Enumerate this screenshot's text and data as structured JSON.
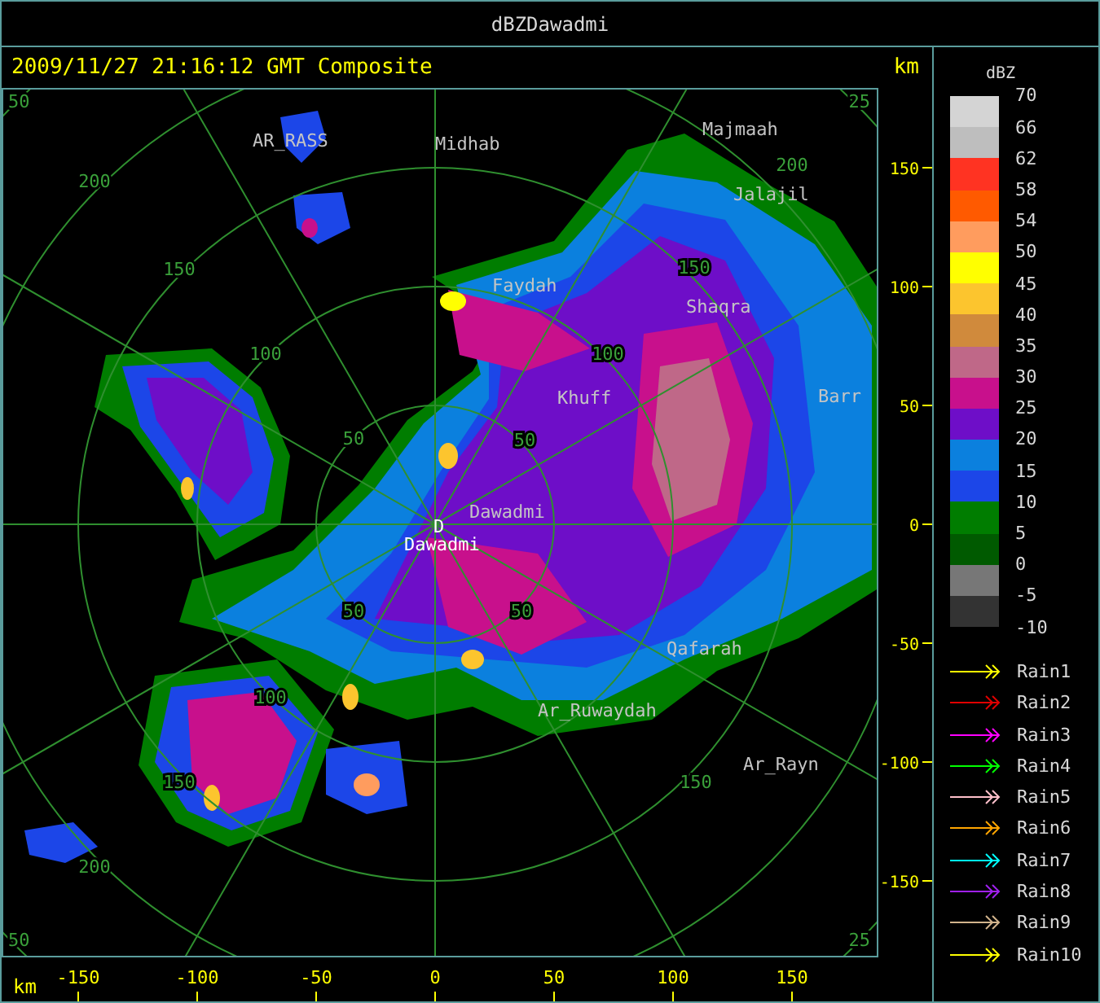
{
  "window": {
    "title": "dBZDawadmi"
  },
  "header": {
    "timestamp": "2009/11/27 21:16:12 GMT Composite"
  },
  "map": {
    "range_labels": {
      "nw": [
        "50",
        "100",
        "150",
        "200",
        "50"
      ],
      "ne": [
        "50",
        "100",
        "150",
        "200",
        "25"
      ],
      "sw": [
        "50",
        "100",
        "150",
        "200",
        "50"
      ],
      "se": [
        "50",
        "150",
        "25"
      ]
    },
    "places": [
      {
        "name": "AR_RASS",
        "kind": "town"
      },
      {
        "name": "Midhab",
        "kind": "town"
      },
      {
        "name": "Majmaah",
        "kind": "town"
      },
      {
        "name": "Jalajil",
        "kind": "town"
      },
      {
        "name": "Faydah",
        "kind": "town"
      },
      {
        "name": "Shaqra",
        "kind": "town"
      },
      {
        "name": "Khuff",
        "kind": "town"
      },
      {
        "name": "Barr",
        "kind": "town"
      },
      {
        "name": "Dawadmi",
        "kind": "town"
      },
      {
        "name": "D",
        "kind": "radar"
      },
      {
        "name": "Dawadmi",
        "kind": "radar"
      },
      {
        "name": "Qafarah",
        "kind": "town"
      },
      {
        "name": "Ar_Ruwaydah",
        "kind": "town"
      },
      {
        "name": "Ar_Rayn",
        "kind": "town"
      }
    ]
  },
  "y_axis": {
    "unit": "km",
    "ticks": [
      "150",
      "100",
      "50",
      "0",
      "-50",
      "-100",
      "-150"
    ]
  },
  "x_axis": {
    "unit": "km",
    "ticks": [
      "-150",
      "-100",
      "-50",
      "0",
      "50",
      "100",
      "150"
    ]
  },
  "legend": {
    "title": "dBZ",
    "scale_labels": [
      "70",
      "66",
      "62",
      "58",
      "54",
      "50",
      "45",
      "40",
      "35",
      "30",
      "25",
      "20",
      "15",
      "10",
      "5",
      "0",
      "-5",
      "-10"
    ],
    "bands": [
      {
        "color": "#d4d4d4"
      },
      {
        "color": "#bebebe"
      },
      {
        "color": "#ff3322"
      },
      {
        "color": "#ff5a00"
      },
      {
        "color": "#ff9c5e"
      },
      {
        "color": "#ffff00"
      },
      {
        "color": "#fcc52e"
      },
      {
        "color": "#d08a3c"
      },
      {
        "color": "#bf6888"
      },
      {
        "color": "#c8108c"
      },
      {
        "color": "#6e0ec8"
      },
      {
        "color": "#0b80de"
      },
      {
        "color": "#1c46e8"
      },
      {
        "color": "#007d00"
      },
      {
        "color": "#005a00"
      },
      {
        "color": "#777777"
      },
      {
        "color": "#333333"
      }
    ],
    "tracks": [
      {
        "label": "Rain1",
        "color": "#ffff00"
      },
      {
        "label": "Rain2",
        "color": "#e00000"
      },
      {
        "label": "Rain3",
        "color": "#ff00ff"
      },
      {
        "label": "Rain4",
        "color": "#00ff00"
      },
      {
        "label": "Rain5",
        "color": "#ffc0cb"
      },
      {
        "label": "Rain6",
        "color": "#ffa500"
      },
      {
        "label": "Rain7",
        "color": "#00ffff"
      },
      {
        "label": "Rain8",
        "color": "#a020f0"
      },
      {
        "label": "Rain9",
        "color": "#d2b48c"
      },
      {
        "label": "Rain10",
        "color": "#ffff00"
      }
    ]
  }
}
